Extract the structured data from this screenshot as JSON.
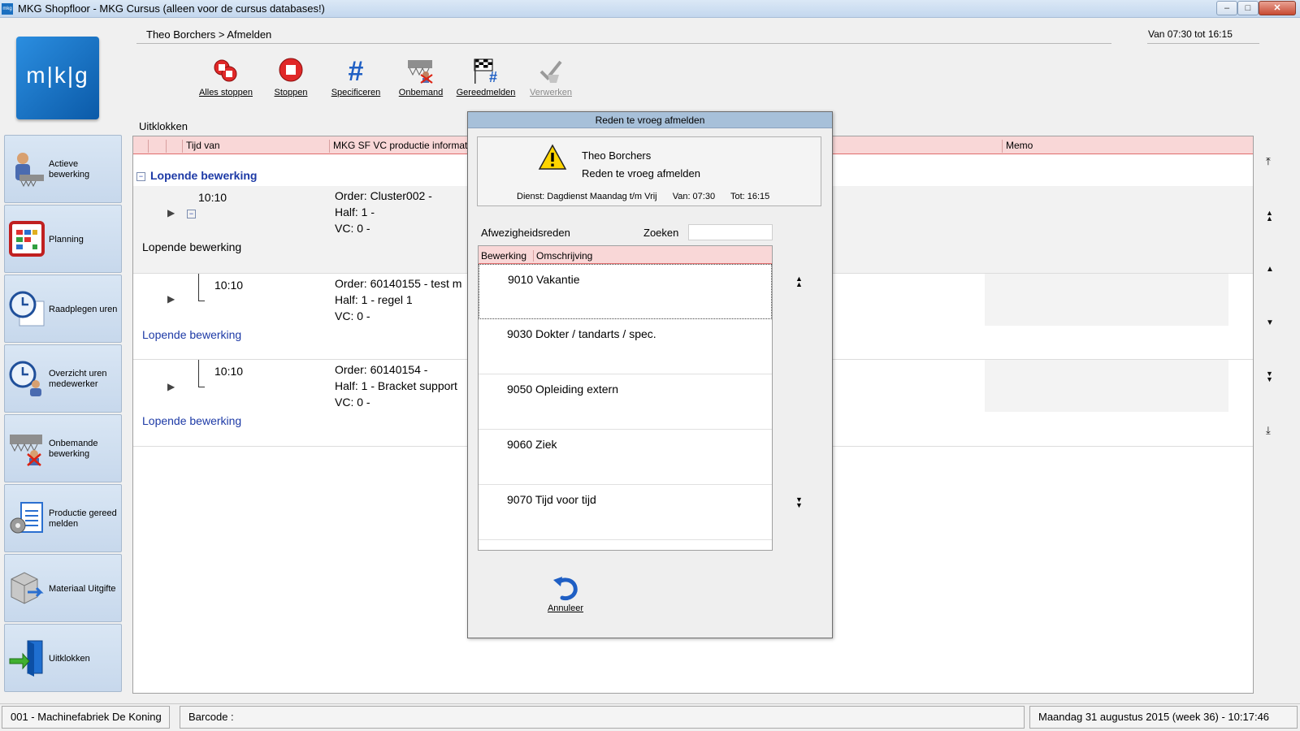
{
  "window": {
    "title": "MKG Shopfloor - MKG Cursus (alleen voor de cursus databases!)",
    "app_icon": "mkg",
    "min_glyph": "–",
    "max_glyph": "□",
    "close_glyph": "✕"
  },
  "logo": {
    "text": "m|k|g"
  },
  "header": {
    "breadcrumb": "Theo Borchers > Afmelden",
    "shift": "Van 07:30 tot 16:15"
  },
  "toolbar": {
    "items": [
      {
        "label": "Alles stoppen",
        "icon": "stop-all-icon"
      },
      {
        "label": "Stoppen",
        "icon": "stop-icon"
      },
      {
        "label": "Specificeren",
        "icon": "hash-icon"
      },
      {
        "label": "Onbemand",
        "icon": "unmanned-icon"
      },
      {
        "label": "Gereedmelden",
        "icon": "finish-flag-icon"
      },
      {
        "label": "Verwerken",
        "icon": "process-icon"
      }
    ]
  },
  "sidebar": {
    "items": [
      {
        "label": "Actieve bewerking",
        "icon": "worker-icon"
      },
      {
        "label": "Planning",
        "icon": "calendar-icon"
      },
      {
        "label": "Raadplegen uren",
        "icon": "clock-icon"
      },
      {
        "label": "Overzicht uren medewerker",
        "icon": "clock-person-icon"
      },
      {
        "label": "Onbemande bewerking",
        "icon": "unmanned-icon"
      },
      {
        "label": "Productie gereed melden",
        "icon": "production-ready-icon"
      },
      {
        "label": "Materiaal Uitgifte",
        "icon": "material-icon"
      },
      {
        "label": "Uitklokken",
        "icon": "exit-door-icon"
      }
    ]
  },
  "main": {
    "section_title": "Uitklokken",
    "columns": [
      "Tijd van",
      "MKG SF VC productie informat",
      "Memo"
    ],
    "group_title": "Lopende bewerking",
    "collapse_glyph": "−",
    "play_glyph": "▶",
    "rows": [
      {
        "time": "10:10",
        "order": "Order: Cluster002 -",
        "half": "Half: 1 -",
        "vc": "VC: 0 -",
        "status": "Lopende bewerking"
      },
      {
        "time": "10:10",
        "order": "Order: 60140155 - test m",
        "half": "Half: 1 - regel 1",
        "vc": "VC: 0 -",
        "status": "Lopende bewerking"
      },
      {
        "time": "10:10",
        "order": "Order: 60140154 -",
        "half": "Half: 1 - Bracket support",
        "vc": "VC: 0 -",
        "status": "Lopende bewerking"
      }
    ],
    "nav": [
      "⤒",
      "▲▲",
      "▲",
      "▼",
      "▼▼",
      "⤓"
    ]
  },
  "dialog": {
    "title": "Reden te vroeg afmelden",
    "user": "Theo Borchers",
    "reason": "Reden te vroeg afmelden",
    "dienst": "Dienst: Dagdienst Maandag t/m Vrij",
    "van": "Van: 07:30",
    "tot": "Tot: 16:15",
    "absence_label": "Afwezigheidsreden",
    "search_label": "Zoeken",
    "search_value": "",
    "list_columns": [
      "Bewerking",
      "Omschrijving"
    ],
    "items": [
      "9010 Vakantie",
      "9030 Dokter / tandarts / spec.",
      "9050 Opleiding extern",
      "9060 Ziek",
      "9070 Tijd voor tijd"
    ],
    "nav": [
      "▲▲",
      "▼▼"
    ],
    "cancel_label": "Annuleer"
  },
  "statusbar": {
    "company": "001 - Machinefabriek De Koning",
    "barcode_label": "Barcode :",
    "datetime": "Maandag 31 augustus 2015 (week 36) - 10:17:46"
  },
  "colors": {
    "header_accent": "#e06c6c",
    "header_bg": "#f9d7d7",
    "link_blue": "#1d3aa6",
    "dialog_title_bg": "#a7c0d9"
  }
}
